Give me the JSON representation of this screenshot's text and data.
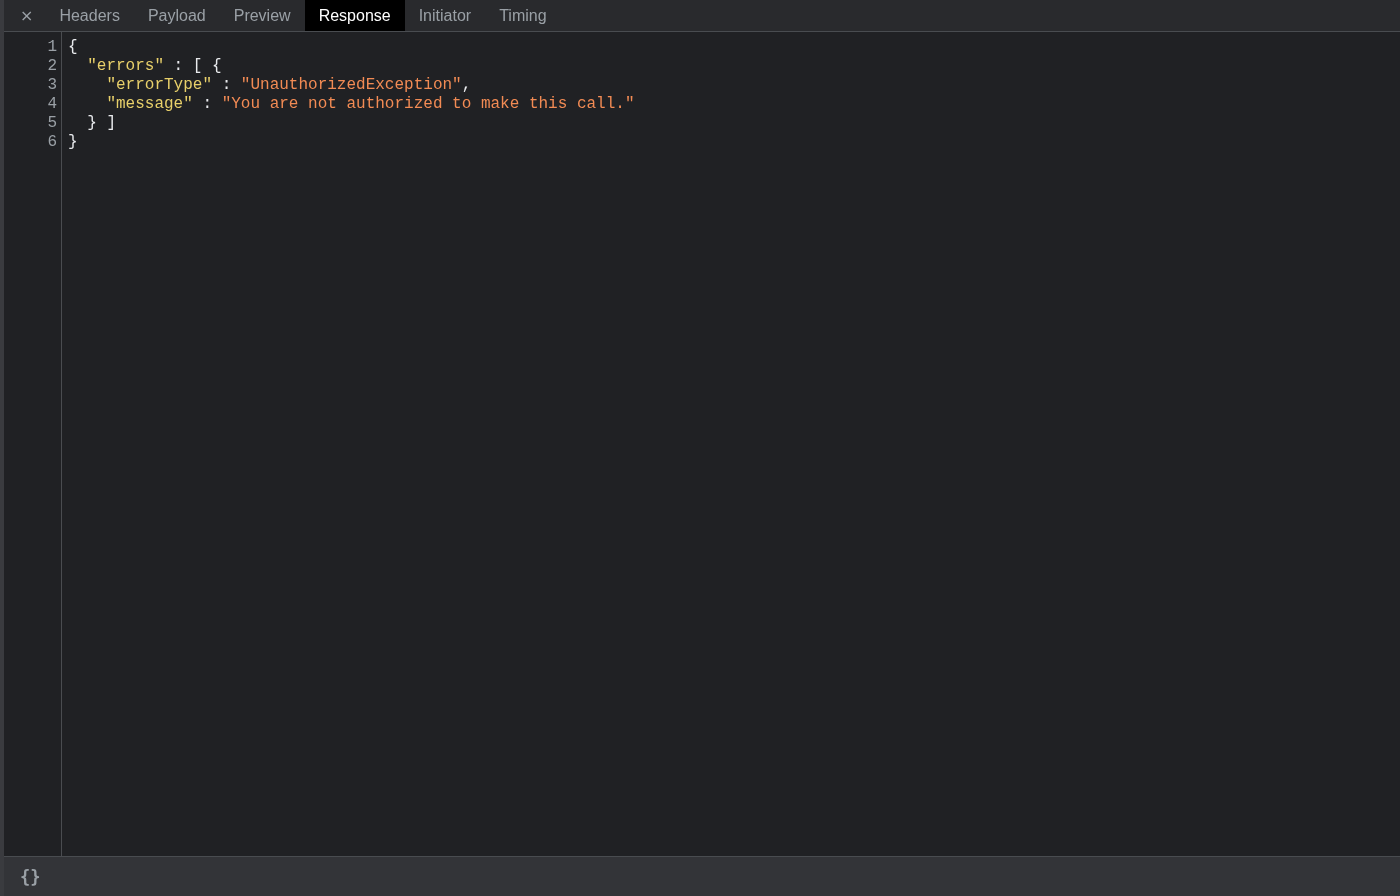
{
  "close_button": "×",
  "tabs": [
    {
      "label": "Headers",
      "selected": false
    },
    {
      "label": "Payload",
      "selected": false
    },
    {
      "label": "Preview",
      "selected": false
    },
    {
      "label": "Response",
      "selected": true
    },
    {
      "label": "Initiator",
      "selected": false
    },
    {
      "label": "Timing",
      "selected": false
    }
  ],
  "code_lines": [
    {
      "number": "1",
      "tokens": [
        {
          "kind": "punct",
          "text": "{"
        }
      ]
    },
    {
      "number": "2",
      "tokens": [
        {
          "kind": "key",
          "text": "  \"errors\""
        },
        {
          "kind": "punct",
          "text": " : [ {"
        }
      ]
    },
    {
      "number": "3",
      "tokens": [
        {
          "kind": "key",
          "text": "    \"errorType\""
        },
        {
          "kind": "punct",
          "text": " : "
        },
        {
          "kind": "string",
          "text": "\"UnauthorizedException\""
        },
        {
          "kind": "punct",
          "text": ","
        }
      ]
    },
    {
      "number": "4",
      "tokens": [
        {
          "kind": "key",
          "text": "    \"message\""
        },
        {
          "kind": "punct",
          "text": " : "
        },
        {
          "kind": "string",
          "text": "\"You are not authorized to make this call.\""
        }
      ]
    },
    {
      "number": "5",
      "tokens": [
        {
          "kind": "punct",
          "text": "  } ]"
        }
      ]
    },
    {
      "number": "6",
      "tokens": [
        {
          "kind": "punct",
          "text": "}"
        }
      ]
    }
  ],
  "footer": {
    "pretty_print_button": "{}"
  }
}
